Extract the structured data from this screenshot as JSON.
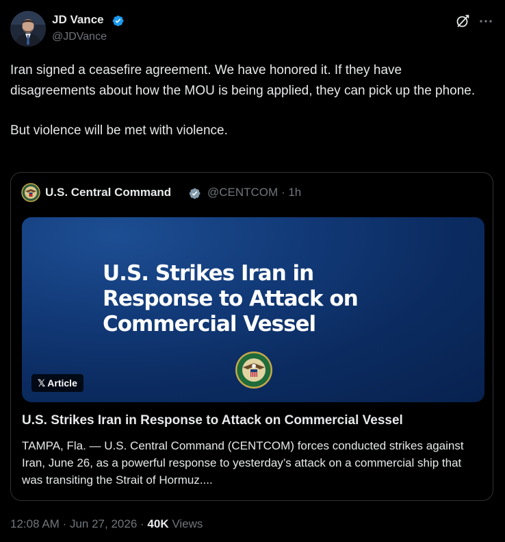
{
  "author": {
    "name": "JD Vance",
    "handle": "@JDVance",
    "verified": true
  },
  "tweet": {
    "paragraphs": [
      "Iran signed a ceasefire agreement. We have honored it. If they have disagreements about how the MOU is being applied, they can pick up the phone.",
      "But violence will be met with violence."
    ]
  },
  "quote": {
    "author_name": "U.S. Central Command",
    "handle": "@CENTCOM",
    "separator": "·",
    "time": "1h",
    "image_headline": "U.S. Strikes Iran in Response to Attack on Commercial Vessel",
    "badge_label": "Article",
    "article_title": "U.S. Strikes Iran in Response to Attack on Commercial Vessel",
    "article_description": "TAMPA, Fla. — U.S. Central Command (CENTCOM) forces conducted strikes against Iran, June 26, as a powerful response to yesterday’s attack on a commercial ship that was transiting the Strait of Hormuz...."
  },
  "footer": {
    "time": "12:08 AM",
    "separator": "·",
    "date": "Jun 27, 2026",
    "views_count": "40K",
    "views_label": "Views"
  },
  "icons": {
    "verified": "verified-badge-icon",
    "grok": "grok-icon",
    "more": "more-options-icon",
    "x_logo": "x-logo-icon"
  },
  "colors": {
    "background": "#000000",
    "text": "#e7e9ea",
    "secondary": "#71767b",
    "verified_blue": "#1d9bf0",
    "card_border": "#2f3336",
    "image_bg": "#0b2b60"
  }
}
